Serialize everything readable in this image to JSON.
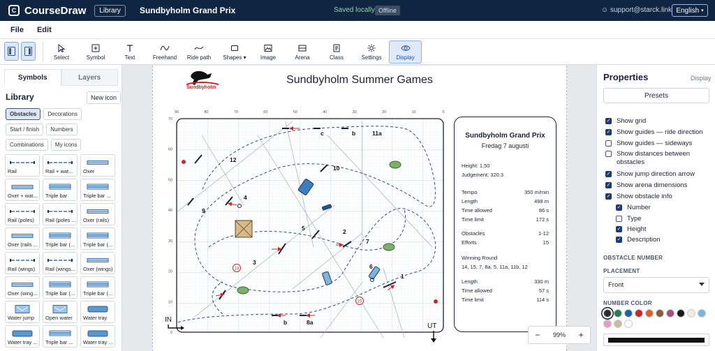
{
  "app": {
    "name": "CourseDraw",
    "library_button": "Library",
    "doc_title": "Sundbyholm Grand Prix",
    "saved_status": "Saved locally",
    "offline_badge": "Offline",
    "user": "support@starck.link",
    "language": "English"
  },
  "menu": [
    "File",
    "Edit"
  ],
  "toolbar": {
    "tools": [
      {
        "label": "Select",
        "icon": "cursor-icon"
      },
      {
        "label": "Symbol",
        "icon": "plus-square-icon"
      },
      {
        "label": "Text",
        "icon": "text-icon"
      },
      {
        "label": "Freehand",
        "icon": "freehand-icon"
      },
      {
        "label": "Ride path",
        "icon": "ride-path-icon"
      },
      {
        "label": "Shapes",
        "icon": "shapes-icon"
      },
      {
        "label": "Image",
        "icon": "image-icon"
      },
      {
        "label": "Arena",
        "icon": "arena-icon"
      },
      {
        "label": "Class",
        "icon": "class-icon"
      },
      {
        "label": "Settings",
        "icon": "settings-icon"
      },
      {
        "label": "Display",
        "icon": "eye-icon",
        "active": true
      }
    ]
  },
  "left": {
    "tabs": [
      "Symbols",
      "Layers"
    ],
    "library_title": "Library",
    "new_icon": "New icon",
    "chips": [
      "Obstacles",
      "Decorations",
      "Start / finish",
      "Numbers",
      "Combinations",
      "My icons"
    ],
    "active_chip": "Obstacles",
    "symbols": [
      {
        "label": "Rail",
        "kind": "rail"
      },
      {
        "label": "Rail + wat...",
        "kind": "rail"
      },
      {
        "label": "Oxer",
        "kind": "oxer"
      },
      {
        "label": "Oxer + wat...",
        "kind": "oxer"
      },
      {
        "label": "Triple bar",
        "kind": "triple"
      },
      {
        "label": "Triple bar ...",
        "kind": "triple"
      },
      {
        "label": "Rail (poles)",
        "kind": "rail"
      },
      {
        "label": "Rail (poles ...",
        "kind": "rail"
      },
      {
        "label": "Oxer (rails)",
        "kind": "oxer"
      },
      {
        "label": "Oxer (rails ...",
        "kind": "oxer"
      },
      {
        "label": "Triple bar (...",
        "kind": "triple"
      },
      {
        "label": "Triple bar (...",
        "kind": "triple"
      },
      {
        "label": "Rail (wings)",
        "kind": "rail"
      },
      {
        "label": "Rail (wings...",
        "kind": "rail"
      },
      {
        "label": "Oxer (wings)",
        "kind": "oxer"
      },
      {
        "label": "Oxer (wing...",
        "kind": "oxer"
      },
      {
        "label": "Triple bar (...",
        "kind": "triple"
      },
      {
        "label": "Triple bar (...",
        "kind": "triple"
      },
      {
        "label": "Water jump",
        "kind": "water"
      },
      {
        "label": "Open water",
        "kind": "water"
      },
      {
        "label": "Water tray",
        "kind": "tray"
      },
      {
        "label": "Water tray ...",
        "kind": "tray"
      },
      {
        "label": "Triple bar ...",
        "kind": "triple"
      },
      {
        "label": "Water tray ...",
        "kind": "tray"
      }
    ]
  },
  "course": {
    "title": "Sundbyholm Summer Games",
    "logo_text": "Sundbyholm",
    "top_ticks": [
      "90",
      "80",
      "70",
      "60",
      "50",
      "40",
      "30",
      "20",
      "10",
      "0"
    ],
    "left_ticks": [
      "70",
      "60",
      "50",
      "40",
      "30",
      "20",
      "10",
      "0"
    ],
    "entry_label": "IN",
    "exit_label": "UT",
    "obstacle_labels": [
      "1",
      "2",
      "3",
      "4",
      "5",
      "6",
      "7",
      "8a",
      "b",
      "9",
      "10",
      "11a",
      "b",
      "c",
      "12"
    ],
    "circled_numbers": [
      "14",
      "15"
    ]
  },
  "info": {
    "title": "Sundbyholm Grand Prix",
    "date": "Fredag 7 augusti",
    "height": "Height: 1,50",
    "judgement": "Judgement: 320.3",
    "rows1": [
      [
        "Tempo",
        "350 m/min"
      ],
      [
        "Length",
        "498 m"
      ],
      [
        "Time allowed",
        "86 s"
      ],
      [
        "Time limit",
        "172 s"
      ]
    ],
    "rows2": [
      [
        "Obstacles",
        "1-12"
      ],
      [
        "Efforts",
        "15"
      ]
    ],
    "winning_round": "Winning Round",
    "winning_sequence": "14, 15, 7, 8a, 5, 11a, 11b, 12",
    "rows3": [
      [
        "Length",
        "330 m"
      ],
      [
        "Time allowed",
        "57 s"
      ],
      [
        "Time limit",
        "114 s"
      ]
    ]
  },
  "zoom": {
    "minus": "−",
    "value": "99%",
    "plus": "+"
  },
  "right": {
    "title": "Properties",
    "display_link": "Display",
    "presets": "Presets",
    "checks": [
      {
        "label": "Show grid",
        "checked": true
      },
      {
        "label": "Show guides — ride direction",
        "checked": true
      },
      {
        "label": "Show guides — sideways",
        "checked": false
      },
      {
        "label": "Show distances between obstacles",
        "checked": false
      },
      {
        "label": "Show jump direction arrow",
        "checked": true
      },
      {
        "label": "Show arena dimensions",
        "checked": true
      },
      {
        "label": "Show obstacle info",
        "checked": true
      }
    ],
    "sub_checks": [
      {
        "label": "Number",
        "checked": true
      },
      {
        "label": "Type",
        "checked": false
      },
      {
        "label": "Height",
        "checked": true
      },
      {
        "label": "Description",
        "checked": true
      }
    ],
    "section_obstacle_number": "OBSTACLE NUMBER",
    "placement_label": "PLACEMENT",
    "placement_value": "Front",
    "number_color_label": "NUMBER COLOR",
    "colors": [
      "#2b2d31",
      "#2e7d4f",
      "#1f5fa8",
      "#c62828",
      "#d9622b",
      "#8b5a3c",
      "#a84e7a",
      "#1a1a1a",
      "#f3ecdc",
      "#7fb3d9",
      "#e89cc0",
      "#cbbba0",
      "#ffffff"
    ]
  }
}
